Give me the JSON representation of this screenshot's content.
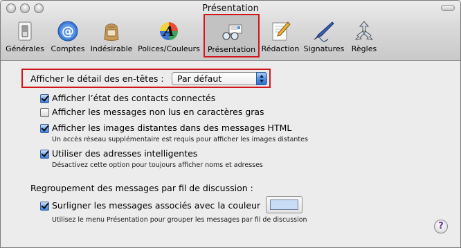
{
  "window": {
    "title": "Présentation"
  },
  "toolbar": {
    "items": [
      {
        "label": "Générales",
        "icon": "light-switch-icon"
      },
      {
        "label": "Comptes",
        "icon": "at-sign-icon"
      },
      {
        "label": "Indésirable",
        "icon": "junk-bag-icon"
      },
      {
        "label": "Polices/Couleurs",
        "icon": "font-color-icon"
      },
      {
        "label": "Présentation",
        "icon": "viewing-glasses-icon",
        "selected": true
      },
      {
        "label": "Rédaction",
        "icon": "pencil-compose-icon"
      },
      {
        "label": "Signatures",
        "icon": "fountain-pen-icon"
      },
      {
        "label": "Règles",
        "icon": "rules-arrows-icon"
      }
    ]
  },
  "headers": {
    "label": "Afficher le détail des en-têtes :",
    "selected": "Par défaut"
  },
  "options": {
    "status": {
      "label": "Afficher l’état des contacts connectés",
      "checked": true
    },
    "bold_unread": {
      "label": "Afficher les messages non lus en caractères gras",
      "checked": false
    },
    "remote_images": {
      "label": "Afficher les images distantes dans des messages HTML",
      "note": "Un accès réseau supplémentaire est requis pour afficher les images distantes",
      "checked": true
    },
    "smart_addresses": {
      "label": "Utiliser des adresses intelligentes",
      "note": "Désactivez cette option pour toujours afficher noms et adresses",
      "checked": true
    }
  },
  "threads": {
    "heading": "Regroupement des messages par fil de discussion :",
    "highlight_label": "Surligner les messages associés avec la couleur",
    "highlight_checked": true,
    "note": "Utilisez le menu Présentation pour grouper les messages par fil de discussion",
    "color": "#c9dcf6"
  },
  "help": {
    "label": "?"
  },
  "colors": {
    "highlight_red": "#d0161a",
    "checkbox_blue": "#4f8ee0"
  }
}
